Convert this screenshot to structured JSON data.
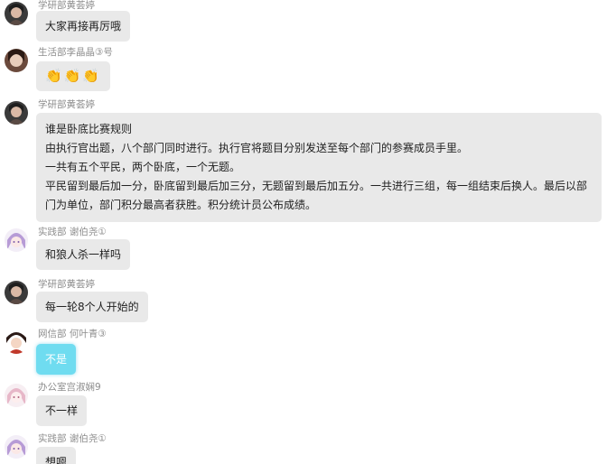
{
  "messages": [
    {
      "sender": "学研部黄荟婷",
      "lines": [
        "大家再接再厉哦"
      ]
    },
    {
      "sender": "生活部李晶晶③号",
      "lines": [
        "👏👏👏"
      ]
    },
    {
      "sender": "学研部黄荟婷",
      "lines": [
        "谁是卧底比赛规则",
        "由执行官出题，八个部门同时进行。执行官将题目分别发送至每个部门的参赛成员手里。",
        "一共有五个平民，两个卧底，一个无题。",
        "平民留到最后加一分，卧底留到最后加三分，无题留到最后加五分。一共进行三组，每一组结束后换人。最后以部门为单位，部门积分最高者获胜。积分统计员公布成绩。"
      ]
    },
    {
      "sender": "实践部 谢伯尧①",
      "lines": [
        "和狼人杀一样吗"
      ]
    },
    {
      "sender": "学研部黄荟婷",
      "lines": [
        "每一轮8个人开始的"
      ]
    },
    {
      "sender": "网信部 何叶青③",
      "lines": [
        "不是"
      ]
    },
    {
      "sender": "办公室宫淑娴9",
      "lines": [
        "不一样"
      ]
    },
    {
      "sender": "实践部 谢伯尧①",
      "lines": [
        "想嗯"
      ]
    }
  ],
  "colors": {
    "bubble": "#e9e9e9",
    "bubble_highlight": "#6fdcf0",
    "sender_text": "#8e8e8e",
    "message_text": "#1f1f1f"
  }
}
